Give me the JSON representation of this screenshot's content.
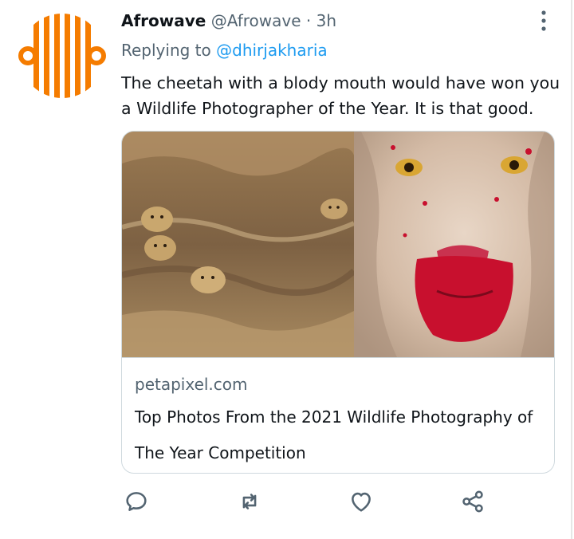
{
  "author": {
    "name": "Afrowave",
    "handle": "@Afrowave",
    "separator": "·",
    "time": "3h"
  },
  "reply": {
    "prefix": "Replying to",
    "mention": "@dhirjakharia"
  },
  "tweet": {
    "text": "The cheetah with a blody mouth would have won you a Wildlife Photographer of the Year. It is that good."
  },
  "card": {
    "domain": "petapixel.com",
    "title": "Top Photos From the 2021 Wildlife Photography of The Year Competition"
  },
  "icons": {
    "avatar": "afrowave-logo",
    "more": "more-vertical-icon",
    "reply": "reply-icon",
    "retweet": "retweet-icon",
    "like": "heart-icon",
    "share": "share-icon"
  },
  "colors": {
    "brand": "#f57c00",
    "link": "#1d9bf0",
    "muted": "#536471",
    "text": "#0f1419",
    "border": "#cfd9de"
  }
}
